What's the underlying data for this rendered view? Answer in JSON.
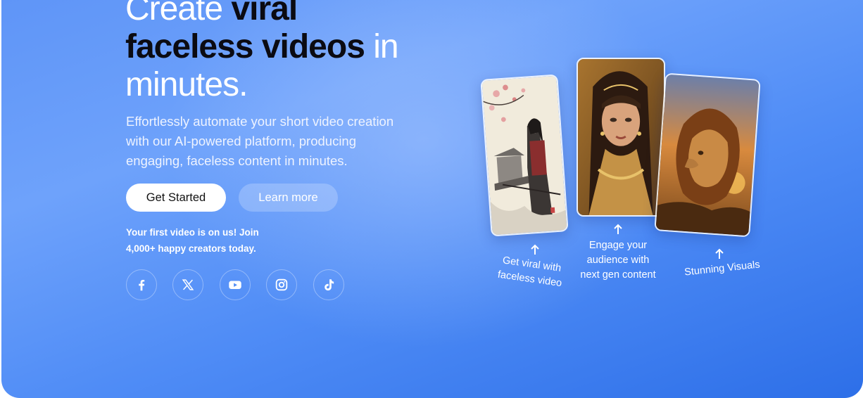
{
  "hero": {
    "headline": {
      "part1": "Create ",
      "part2": "viral",
      "part3": "faceless videos",
      "part4": " in",
      "part5": "minutes."
    },
    "subtitle_lines": [
      "Effortlessly automate your short video creation",
      "with our AI-powered platform, producing",
      "engaging, faceless content in minutes."
    ],
    "buttons": {
      "primary": "Get Started",
      "secondary": "Learn more"
    },
    "note_lines": [
      "Your first video is on us! Join",
      "4,000+ happy creators today."
    ],
    "socials": [
      "facebook-icon",
      "x-icon",
      "youtube-icon",
      "instagram-icon",
      "tiktok-icon"
    ]
  },
  "showcase": {
    "cards": [
      {
        "name": "samurai-image",
        "caption_lines": [
          "Get viral with",
          "faceless video"
        ]
      },
      {
        "name": "woman-portrait-image",
        "caption_lines": [
          "Engage your",
          "audience with",
          "next gen content"
        ]
      },
      {
        "name": "lion-image",
        "caption_lines": [
          "Stunning Visuals"
        ]
      }
    ]
  },
  "colors": {
    "gradient_start": "#6ea2fb",
    "gradient_end": "#2d6fe8",
    "headline_dark": "#0b0b12",
    "white": "#ffffff"
  }
}
